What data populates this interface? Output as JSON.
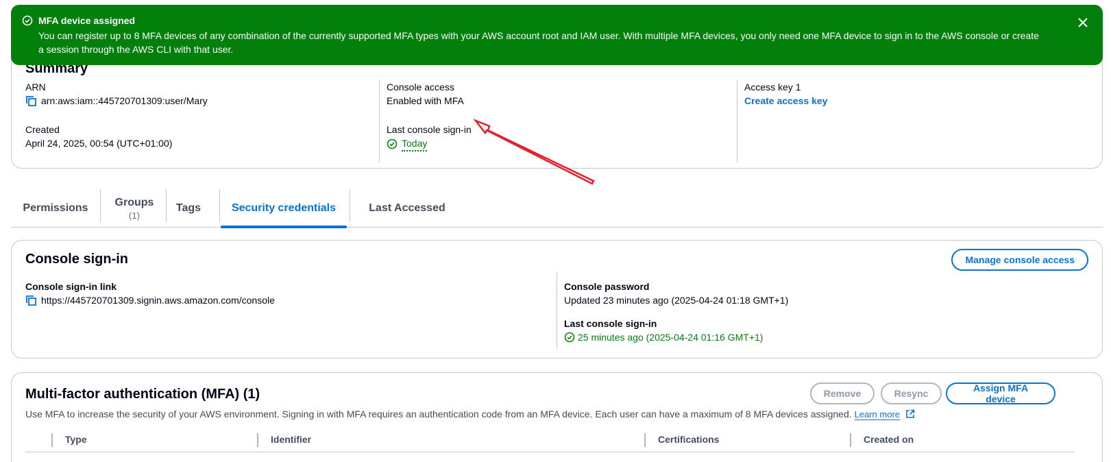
{
  "flash": {
    "title": "MFA device assigned",
    "message": "You can register up to 8 MFA devices of any combination of the currently supported MFA types with your AWS account root and IAM user. With multiple MFA devices, you only need one MFA device to sign in to the AWS console or create a session through the AWS CLI with that user.",
    "color": "#037f0c"
  },
  "summary": {
    "heading": "Summary",
    "arn_label": "ARN",
    "arn_value": "arn:aws:iam::445720701309:user/Mary",
    "created_label": "Created",
    "created_value": "April 24, 2025, 00:54 (UTC+01:00)",
    "console_access_label": "Console access",
    "console_access_value": "Enabled with MFA",
    "last_signin_label": "Last console sign-in",
    "last_signin_value": "Today",
    "access_key_label": "Access key 1",
    "access_key_link": "Create access key"
  },
  "tabs": [
    {
      "label": "Permissions",
      "sub": ""
    },
    {
      "label": "Groups",
      "sub": "(1)"
    },
    {
      "label": "Tags",
      "sub": ""
    },
    {
      "label": "Security credentials",
      "sub": ""
    },
    {
      "label": "Last Accessed",
      "sub": ""
    }
  ],
  "console": {
    "heading": "Console sign-in",
    "manage_button": "Manage console access",
    "link_label": "Console sign-in link",
    "link_value": "https://445720701309.signin.aws.amazon.com/console",
    "password_label": "Console password",
    "password_value": "Updated 23 minutes ago (2025-04-24 01:18 GMT+1)",
    "last_signin_label": "Last console sign-in",
    "last_signin_value": "25 minutes ago (2025-04-24 01:16 GMT+1)"
  },
  "mfa": {
    "heading": "Multi-factor authentication (MFA) (1)",
    "remove_button": "Remove",
    "resync_button": "Resync",
    "assign_button": "Assign MFA device",
    "description": "Use MFA to increase the security of your AWS environment. Signing in with MFA requires an authentication code from an MFA device. Each user can have a maximum of 8 MFA devices assigned.",
    "learn_more": "Learn more",
    "columns": [
      "Type",
      "Identifier",
      "Certifications",
      "Created on"
    ]
  },
  "colors": {
    "accent": "#0972d3",
    "success": "#037f0c",
    "annotation": "#e0222a"
  }
}
